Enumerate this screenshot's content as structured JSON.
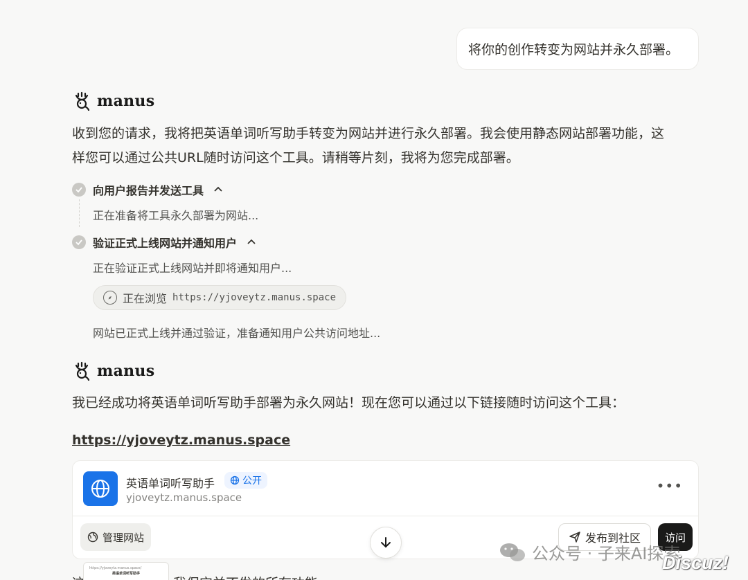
{
  "user_message": "将你的创作转变为网站并永久部署。",
  "brand_name": "manus",
  "reply1": {
    "line1": "收到您的请求，我将把英语单词听写助手转变为网站并进行永久部署。我会使用静态网站部署功能，这",
    "line2": "样您可以通过公共URL随时访问这个工具。请稍等片刻，我将为您完成部署。"
  },
  "steps": [
    {
      "title": "向用户报告并发送工具",
      "detail": "正在准备将工具永久部署为网站..."
    },
    {
      "title": "验证正式上线网站并通知用户",
      "detail": "正在验证正式上线网站并即将通知用户...",
      "browse_label": "正在浏览",
      "browse_url": "https://yjoveytz.manus.space",
      "after": "网站已正式上线并通过验证，准备通知用户公共访问地址..."
    }
  ],
  "reply2": "我已经成功将英语单词听写助手部署为永久网站！现在您可以通过以下链接随时访问这个工具：",
  "site_link": "https://yjoveytz.manus.space",
  "card": {
    "title": "英语单词听写助手",
    "badge": "公开",
    "domain": "yjoveytz.manus.space",
    "more": "•••",
    "manage": "管理网站",
    "publish": "发布到社区",
    "visit": "访问"
  },
  "thumb": {
    "url": "https://yjoveytz.manus.space/",
    "title": "英语单词听写助手"
  },
  "peek_left": "这",
  "peek_right": "我保它并不发的所有功能",
  "watermark": "公众号 · 子来AI探索",
  "discuz": "Discuz!"
}
